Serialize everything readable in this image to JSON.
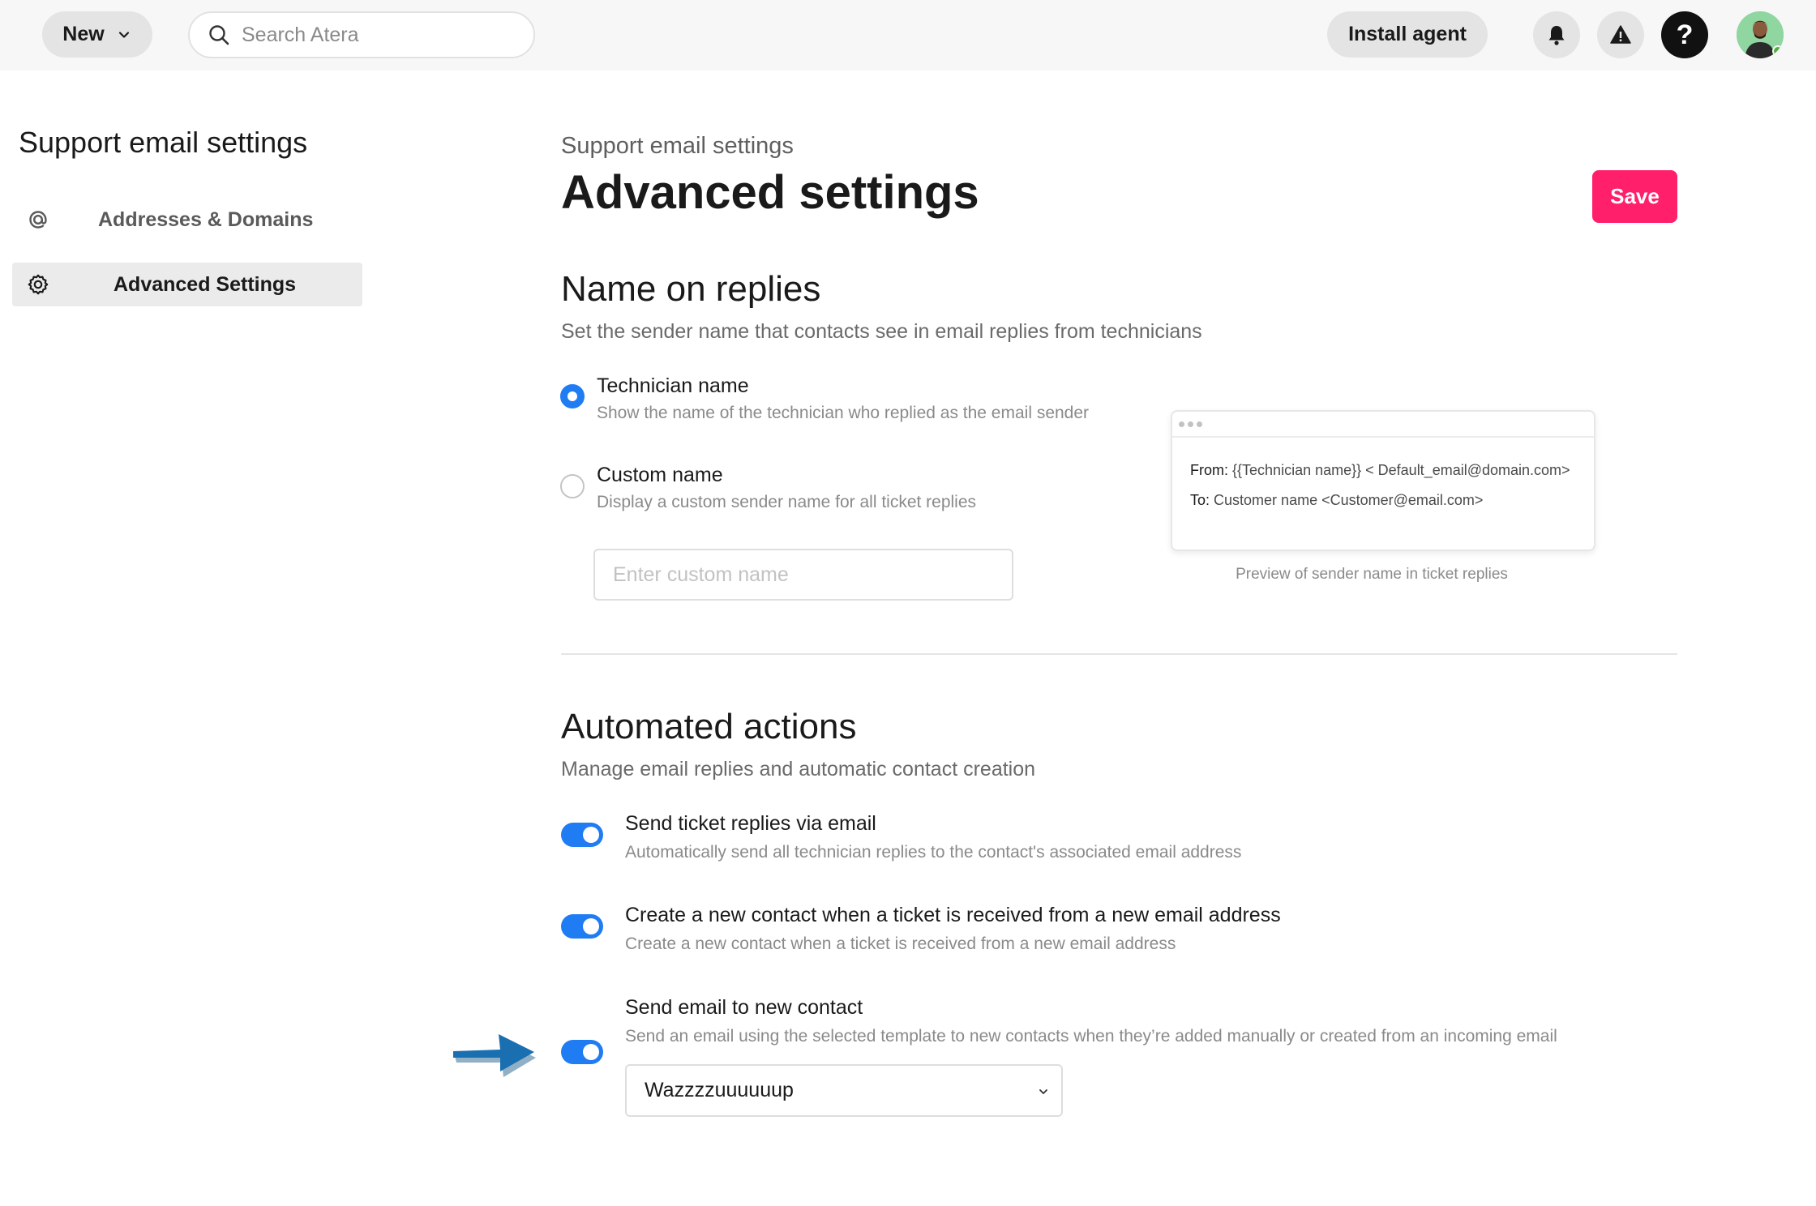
{
  "topbar": {
    "new_label": "New",
    "search_placeholder": "Search Atera",
    "install_label": "Install agent",
    "help_glyph": "?",
    "icons": [
      "chevron-down-icon",
      "search-icon",
      "bell-icon",
      "warning-icon",
      "help-icon",
      "avatar"
    ]
  },
  "sidebar": {
    "title": "Support email settings",
    "items": [
      {
        "label": "Addresses & Domains",
        "icon": "at-sign-icon",
        "active": false
      },
      {
        "label": "Advanced Settings",
        "icon": "gear-icon",
        "active": true
      }
    ]
  },
  "main": {
    "breadcrumb": "Support email settings",
    "title": "Advanced settings",
    "save_label": "Save"
  },
  "name_on_replies": {
    "title": "Name on replies",
    "subtitle": "Set the sender name that contacts see in email replies from technicians",
    "options": [
      {
        "label": "Technician name",
        "desc": "Show the name of the technician who replied as the email sender",
        "selected": true
      },
      {
        "label": "Custom name",
        "desc": "Display a custom sender name for all ticket replies",
        "selected": false
      }
    ],
    "custom_placeholder": "Enter custom name",
    "custom_value": "",
    "preview": {
      "from_label": "From:",
      "from_value": "{{Technician name}} < Default_email@domain.com>",
      "to_label": "To:",
      "to_value": "Customer name <Customer@email.com>",
      "caption": "Preview of sender name in ticket replies"
    }
  },
  "automated_actions": {
    "title": "Automated actions",
    "subtitle": "Manage email replies and automatic contact creation",
    "toggles": [
      {
        "label": "Send ticket replies via email",
        "desc": "Automatically send all technician replies to the contact's associated email address",
        "on": true
      },
      {
        "label": "Create a new contact when a ticket is received from a new email address",
        "desc": "Create a new contact when a ticket is received from a new email address",
        "on": true
      },
      {
        "label": "Send email to new contact",
        "desc": "Send an email using the selected template to new contacts when they’re added manually or created from an incoming email",
        "on": true
      }
    ],
    "template_selected": "Wazzzzuuuuuup"
  },
  "colors": {
    "accent_blue": "#1f7cf2",
    "save_pink": "#ff1f6b",
    "annotation_arrow": "#1a6fb0"
  }
}
